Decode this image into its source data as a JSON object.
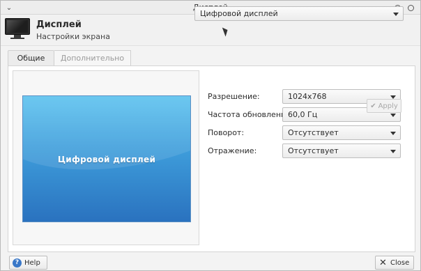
{
  "window": {
    "title": "Дисплей"
  },
  "header": {
    "title": "Дисплей",
    "subtitle": "Настройки экрана"
  },
  "tabs": [
    {
      "label": "Общие",
      "active": true
    },
    {
      "label": "Дополнительно",
      "active": false
    }
  ],
  "preview": {
    "label": "Цифровой дисплей"
  },
  "output_select": {
    "value": "Цифровой дисплей"
  },
  "settings": [
    {
      "label": "Разрешение:",
      "value": "1024x768"
    },
    {
      "label": "Частота обновления:",
      "value": "60,0 Гц"
    },
    {
      "label": "Поворот:",
      "value": "Отсутствует"
    },
    {
      "label": "Отражение:",
      "value": "Отсутствует"
    }
  ],
  "buttons": {
    "apply": "Apply",
    "help": "Help",
    "close": "Close"
  },
  "icons": {
    "window_menu": "chevron-down-icon",
    "keep_above": "triangle-up-icon",
    "minimize": "circle-icon",
    "maximize": "circle-icon",
    "app": "monitor-icon",
    "apply": "checkmark-icon",
    "help": "help-icon",
    "close": "close-icon"
  },
  "colors": {
    "preview_top": "#5cc2ef",
    "preview_bottom": "#2a72bf",
    "help_icon": "#3a78c8"
  }
}
